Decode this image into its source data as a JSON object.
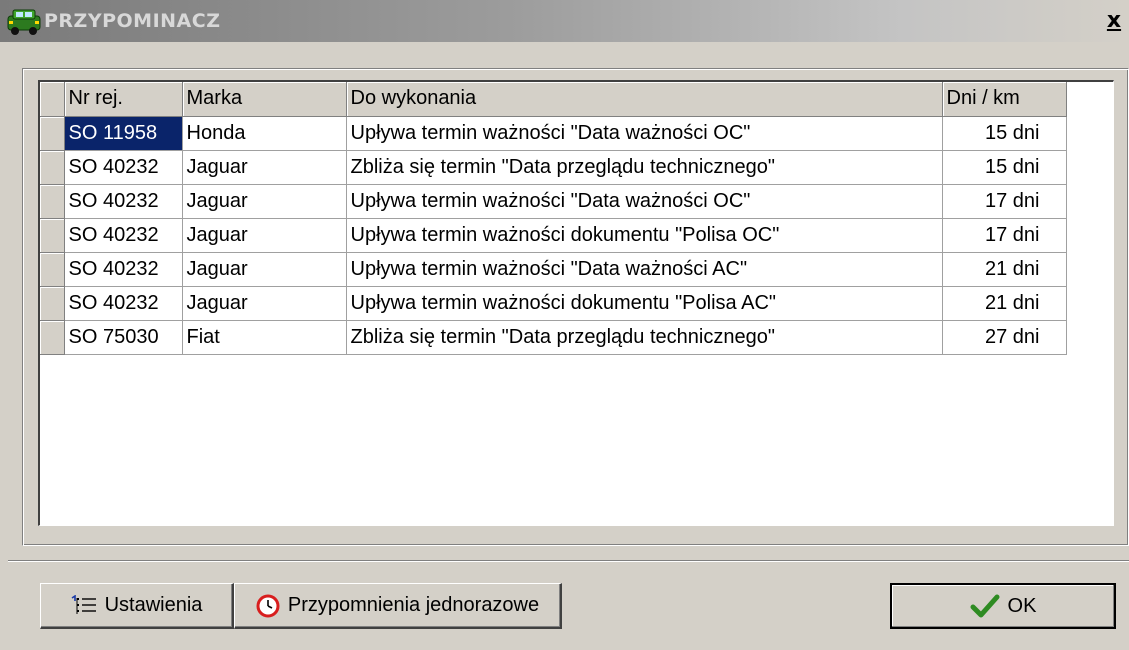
{
  "window": {
    "title": "PRZYPOMINACZ",
    "close_label": "x"
  },
  "table": {
    "columns": [
      "Nr rej.",
      "Marka",
      "Do wykonania",
      "Dni / km"
    ],
    "rows": [
      {
        "nr": "SO 11958",
        "marka": "Honda",
        "task": "Upływa termin ważności \"Data ważności OC\"",
        "dni": "15 dni",
        "selected": true
      },
      {
        "nr": "SO 40232",
        "marka": "Jaguar",
        "task": "Zbliża się termin \"Data przeglądu technicznego\"",
        "dni": "15 dni"
      },
      {
        "nr": "SO 40232",
        "marka": "Jaguar",
        "task": "Upływa termin ważności \"Data ważności OC\"",
        "dni": "17 dni"
      },
      {
        "nr": "SO 40232",
        "marka": "Jaguar",
        "task": "Upływa termin ważności dokumentu \"Polisa OC\"",
        "dni": "17 dni"
      },
      {
        "nr": "SO 40232",
        "marka": "Jaguar",
        "task": "Upływa termin ważności \"Data ważności AC\"",
        "dni": "21 dni"
      },
      {
        "nr": "SO 40232",
        "marka": "Jaguar",
        "task": "Upływa termin ważności dokumentu \"Polisa AC\"",
        "dni": "21 dni"
      },
      {
        "nr": "SO 75030",
        "marka": "Fiat",
        "task": "Zbliża się termin \"Data przeglądu technicznego\"",
        "dni": "27 dni"
      }
    ]
  },
  "buttons": {
    "settings": "Ustawienia",
    "one_time": "Przypomnienia jednorazowe",
    "ok": "OK"
  },
  "icons": {
    "app": "car-icon",
    "settings": "list-settings-icon",
    "one_time": "clock-icon",
    "ok": "checkmark-icon"
  },
  "colors": {
    "selection": "#0a246a",
    "face": "#d4d0c8",
    "ok_check": "#2e8b22",
    "clock": "#d81e1e"
  }
}
